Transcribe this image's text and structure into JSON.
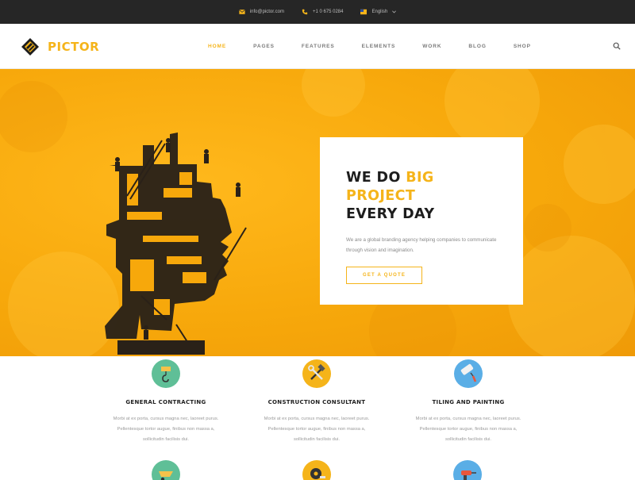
{
  "topbar": {
    "email": "info@pictor.com",
    "phone": "+1 0 675 0284",
    "language": "English"
  },
  "header": {
    "logo_text": "PICTOR",
    "nav": [
      {
        "label": "HOME",
        "active": true
      },
      {
        "label": "PAGES",
        "active": false
      },
      {
        "label": "FEATURES",
        "active": false
      },
      {
        "label": "ELEMENTS",
        "active": false
      },
      {
        "label": "WORK",
        "active": false
      },
      {
        "label": "BLOG",
        "active": false
      },
      {
        "label": "SHOP",
        "active": false
      }
    ]
  },
  "hero": {
    "title_pre": "WE DO ",
    "title_highlight": "BIG PROJECT",
    "title_line2": "EVERY DAY",
    "description": "We are a global branding agency helping companies to communicate through vision and imagination.",
    "button_label": "GET A QUOTE"
  },
  "services": [
    {
      "title": "GENERAL CONTRACTING",
      "line1": "Morbi at ex porta, cursus magna nec, laoreet purus.",
      "line2": "Pellentesque tortor augue, finibus non massa a,",
      "line3": "sollicitudin facilisis dui.",
      "icon": "crane-hook-icon",
      "color": "#5fbf97"
    },
    {
      "title": "CONSTRUCTION CONSULTANT",
      "line1": "Morbi at ex porta, cursus magna nec, laoreet purus.",
      "line2": "Pellentesque tortor augue, finibus non massa a,",
      "line3": "sollicitudin facilisis dui.",
      "icon": "hammer-wrench-icon",
      "color": "#f5b41a"
    },
    {
      "title": "TILING AND PAINTING",
      "line1": "Morbi at ex porta, cursus magna nec, laoreet purus.",
      "line2": "Pellentesque tortor augue, finibus non massa a,",
      "line3": "sollicitudin facilisis dui.",
      "icon": "paint-roller-icon",
      "color": "#5aaee6"
    }
  ],
  "services_row2_icons": [
    {
      "icon": "wheelbarrow-icon",
      "color": "#5fbf97"
    },
    {
      "icon": "measuring-tape-icon",
      "color": "#f5b41a"
    },
    {
      "icon": "drill-icon",
      "color": "#5aaee6"
    }
  ],
  "colors": {
    "accent": "#f5b41a",
    "topbar_bg": "#262626",
    "hero_bg": "#f7a80b",
    "dark": "#1d1d1d"
  }
}
